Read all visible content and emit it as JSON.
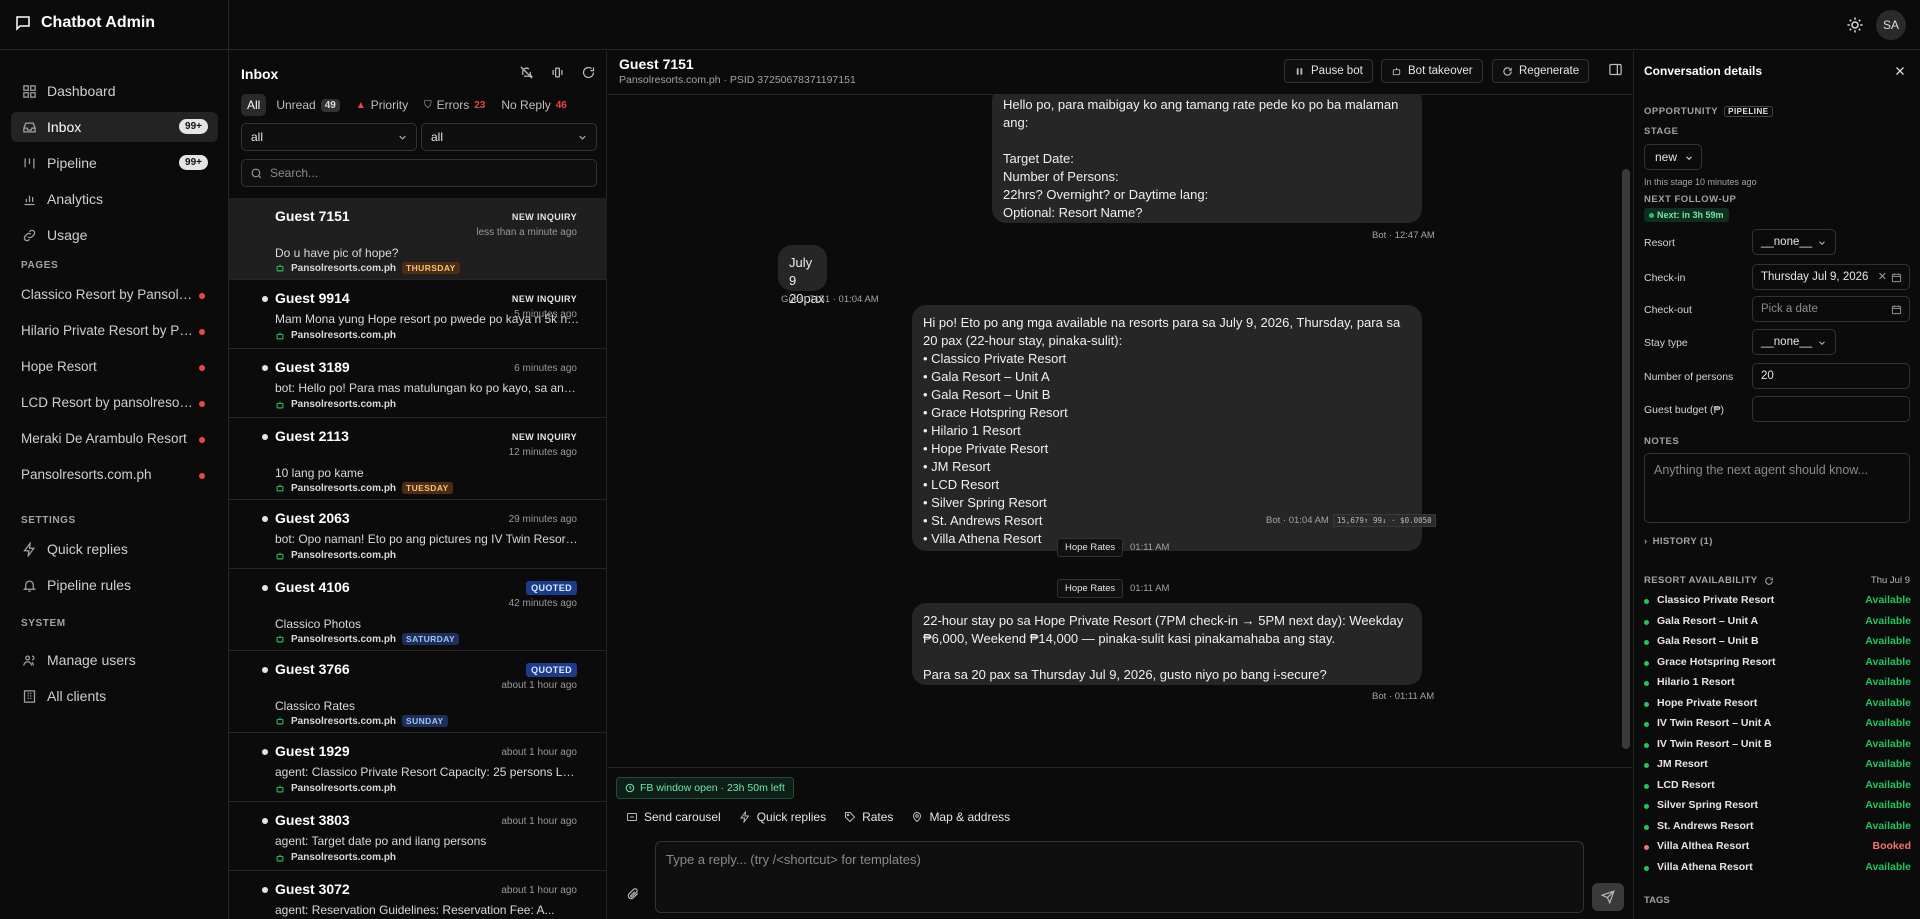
{
  "app": {
    "title": "Chatbot Admin",
    "avatar": "SA"
  },
  "nav": {
    "items": [
      {
        "label": "Dashboard",
        "icon": "grid-icon"
      },
      {
        "label": "Inbox",
        "icon": "inbox-icon",
        "badge": "99+"
      },
      {
        "label": "Pipeline",
        "icon": "kanban-icon",
        "badge": "99+"
      },
      {
        "label": "Analytics",
        "icon": "bar-chart-icon"
      },
      {
        "label": "Usage",
        "icon": "link-icon"
      }
    ],
    "pages_label": "PAGES",
    "pages": [
      "Classico Resort by Pansolr...",
      "Hilario Private Resort by Pa...",
      "Hope Resort",
      "LCD Resort by pansolresor...",
      "Meraki De Arambulo Resort",
      "Pansolresorts.com.ph"
    ],
    "settings_label": "SETTINGS",
    "settings": [
      "Quick replies",
      "Pipeline rules"
    ],
    "system_label": "SYSTEM",
    "system": [
      "Manage users",
      "All clients"
    ]
  },
  "inbox": {
    "title": "Inbox",
    "filters": {
      "all": "All",
      "unread": "Unread",
      "unread_count": "49",
      "priority": "Priority",
      "errors": "Errors",
      "errors_count": "23",
      "noreply": "No Reply",
      "noreply_count": "46"
    },
    "select1": "all",
    "select2": "all",
    "search_placeholder": "Search...",
    "conversations": [
      {
        "name": "Guest 7151",
        "tag": "NEW INQUIRY",
        "time": "less than a minute ago",
        "preview": "Do u have pic of hope?",
        "source": "Pansolresorts.com.ph",
        "day": "THURSDAY",
        "day_color": "orange",
        "unread": false,
        "selected": true
      },
      {
        "name": "Guest 9914",
        "tag": "NEW INQUIRY",
        "time": "5 minutes ago",
        "preview": "Mam Mona yung Hope resort po pwede po kaya n 5k n la...",
        "source": "Pansolresorts.com.ph",
        "day": "",
        "unread": true
      },
      {
        "name": "Guest 3189",
        "tag": "",
        "time": "6 minutes ago",
        "preview": "bot: Hello po! Para mas matulungan ko po kayo, sa anon...",
        "source": "Pansolresorts.com.ph",
        "day": "",
        "unread": true
      },
      {
        "name": "Guest 2113",
        "tag": "NEW INQUIRY",
        "time": "12 minutes ago",
        "preview": "10 lang po kame",
        "source": "Pansolresorts.com.ph",
        "day": "TUESDAY",
        "day_color": "orange",
        "unread": true
      },
      {
        "name": "Guest 2063",
        "tag": "",
        "time": "29 minutes ago",
        "preview": "bot: Opo naman! Eto po ang pictures ng IV Twin Resort – ...",
        "source": "Pansolresorts.com.ph",
        "day": "",
        "unread": true
      },
      {
        "name": "Guest 4106",
        "tag": "QUOTED",
        "time": "42 minutes ago",
        "preview": "Classico Photos",
        "source": "Pansolresorts.com.ph",
        "day": "SATURDAY",
        "day_color": "blue",
        "unread": true
      },
      {
        "name": "Guest 3766",
        "tag": "QUOTED",
        "time": "about 1 hour ago",
        "preview": "Classico Rates",
        "source": "Pansolresorts.com.ph",
        "day": "SUNDAY",
        "day_color": "blue",
        "unread": true
      },
      {
        "name": "Guest 1929",
        "tag": "",
        "time": "about 1 hour ago",
        "preview": "agent: Classico Private Resort Capacity: 25 persons Lot ...",
        "source": "Pansolresorts.com.ph",
        "day": "",
        "unread": true
      },
      {
        "name": "Guest 3803",
        "tag": "",
        "time": "about 1 hour ago",
        "preview": "agent: Target date po and ilang persons",
        "source": "Pansolresorts.com.ph",
        "day": "",
        "unread": true
      },
      {
        "name": "Guest 3072",
        "tag": "",
        "time": "about 1 hour ago",
        "preview": "agent: Reservation Guidelines: Reservation Fee: A...",
        "source": "",
        "day": "",
        "unread": true
      }
    ]
  },
  "chat": {
    "title": "Guest 7151",
    "subtitle": "Pansolresorts.com.ph · PSID 37250678371197151",
    "buttons": {
      "pause": "Pause bot",
      "takeover": "Bot takeover",
      "regenerate": "Regenerate"
    },
    "messages": {
      "m1": "Hello po, para maibigay ko ang tamang rate pede ko po ba malaman ang:\n\nTarget Date:\nNumber of Persons:\n22hrs? Overnight? or Daytime lang:\nOptional: Resort Name?",
      "m1_meta": "Bot  ·  12:47 AM",
      "m2": "July  9\n20pax",
      "m2_meta": "Guest 7151  ·  01:04 AM",
      "m3": "Hi po! Eto po ang mga available na resorts para sa July 9, 2026, Thursday, para sa 20 pax (22-hour stay, pinaka-sulit):\n• Classico Private Resort\n• Gala Resort – Unit A\n• Gala Resort – Unit B\n• Grace Hotspring Resort\n• Hilario 1 Resort\n• Hope Private Resort\n• JM Resort\n• LCD Resort\n• Silver Spring Resort\n• St. Andrews Resort\n• Villa Athena Resort",
      "m3_meta": "Bot  ·  01:04 AM",
      "m3_cost": "15,679↑ 99↓ · $0.0050",
      "pill1": "Hope Rates",
      "pill1_time": "01:11 AM",
      "pill2": "Hope Rates",
      "pill2_time": "01:11 AM",
      "m4": "22-hour stay po sa Hope Private Resort (7PM check-in → 5PM next day): Weekday ₱6,000, Weekend ₱14,000 — pinaka-sulit kasi pinakamahaba ang stay.\n\nPara sa 20 pax sa Thursday Jul 9, 2026, gusto niyo po bang i-secure?",
      "m4_meta": "Bot  ·  01:11 AM"
    },
    "fb_window": "FB window open · 23h 50m left",
    "tools": {
      "carousel": "Send carousel",
      "quick": "Quick replies",
      "rates": "Rates",
      "map": "Map & address"
    },
    "reply_placeholder": "Type a reply... (try /<shortcut> for templates)"
  },
  "details": {
    "title": "Conversation details",
    "opportunity": "OPPORTUNITY",
    "pipeline_tag": "PIPELINE",
    "stage_label": "STAGE",
    "stage": "new",
    "stage_note": "In this stage 10 minutes ago",
    "followup_label": "NEXT FOLLOW-UP",
    "followup": "Next: in 3h 59m",
    "resort_label": "Resort",
    "resort": "__none__",
    "checkin_label": "Check-in",
    "checkin": "Thursday Jul 9, 2026",
    "checkout_label": "Check-out",
    "checkout_placeholder": "Pick a date",
    "staytype_label": "Stay type",
    "staytype": "__none__",
    "persons_label": "Number of persons",
    "persons": "20",
    "budget_label": "Guest budget (₱)",
    "notes_label": "NOTES",
    "notes_placeholder": "Anything the next agent should know...",
    "history": "HISTORY (1)",
    "availability_label": "RESORT AVAILABILITY",
    "availability_date": "Thu Jul 9",
    "availability": [
      {
        "name": "Classico Private Resort",
        "status": "Available"
      },
      {
        "name": "Gala Resort – Unit A",
        "status": "Available"
      },
      {
        "name": "Gala Resort – Unit B",
        "status": "Available"
      },
      {
        "name": "Grace Hotspring Resort",
        "status": "Available"
      },
      {
        "name": "Hilario 1 Resort",
        "status": "Available"
      },
      {
        "name": "Hope Private Resort",
        "status": "Available"
      },
      {
        "name": "IV Twin Resort – Unit A",
        "status": "Available"
      },
      {
        "name": "IV Twin Resort – Unit B",
        "status": "Available"
      },
      {
        "name": "JM Resort",
        "status": "Available"
      },
      {
        "name": "LCD Resort",
        "status": "Available"
      },
      {
        "name": "Silver Spring Resort",
        "status": "Available"
      },
      {
        "name": "St. Andrews Resort",
        "status": "Available"
      },
      {
        "name": "Villa Althea Resort",
        "status": "Booked"
      },
      {
        "name": "Villa Athena Resort",
        "status": "Available"
      }
    ],
    "tags_label": "TAGS",
    "colors": {
      "available": "#22c55e",
      "booked": "#f87171"
    }
  }
}
